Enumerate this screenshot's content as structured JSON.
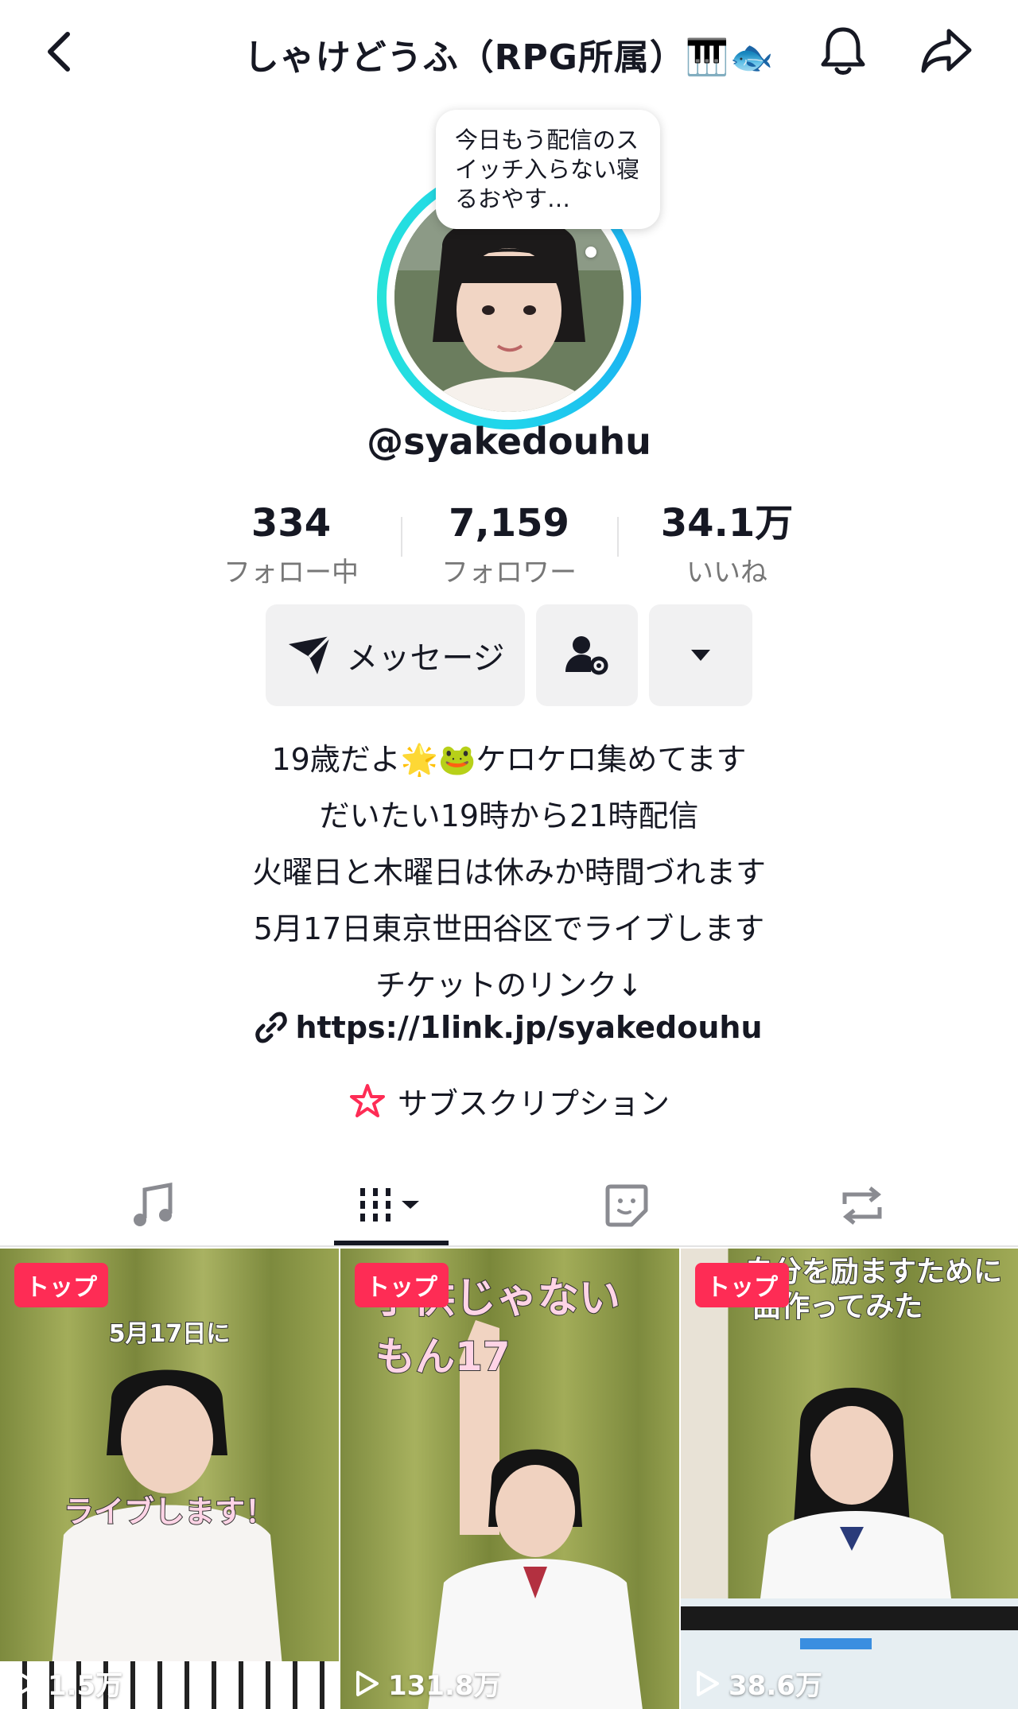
{
  "header": {
    "title": "しゃけどうふ（RPG所属）🎹🐟",
    "back_icon": "chevron-left-icon",
    "bell_icon": "bell-icon",
    "share_icon": "share-icon"
  },
  "bubble": {
    "text": "今日もう配信のスイッチ入らない寝るおやす…"
  },
  "profile": {
    "username": "@syakedouhu"
  },
  "stats": [
    {
      "value": "334",
      "label": "フォロー中"
    },
    {
      "value": "7,159",
      "label": "フォロワー"
    },
    {
      "value": "34.1万",
      "label": "いいね"
    }
  ],
  "actions": {
    "message_label": "メッセージ"
  },
  "bio": {
    "lines": [
      "19歳だよ🌟🐸ケロケロ集めてます",
      "だいたい19時から21時配信",
      "火曜日と木曜日は休みか時間づれます",
      "5月17日東京世田谷区でライブします",
      "チケットのリンク↓"
    ],
    "link": "https://1link.jp/syakedouhu",
    "subscription": "サブスクリプション"
  },
  "tabs": [
    "music-icon",
    "grid-icon",
    "sticker-icon",
    "repost-icon"
  ],
  "videos": [
    {
      "badge": "トップ",
      "views": "1.5万",
      "caption_top": "5月17日に",
      "caption_mid": "ライブします！"
    },
    {
      "badge": "トップ",
      "views": "131.8万",
      "caption_top": "子供じゃない",
      "caption_mid": "もん17"
    },
    {
      "badge": "トップ",
      "views": "38.6万",
      "caption_top": "自分を励ますために",
      "caption_mid": "曲作ってみた"
    }
  ],
  "colors": {
    "accent": "#fe2c55",
    "ring": "#20d5ec"
  }
}
